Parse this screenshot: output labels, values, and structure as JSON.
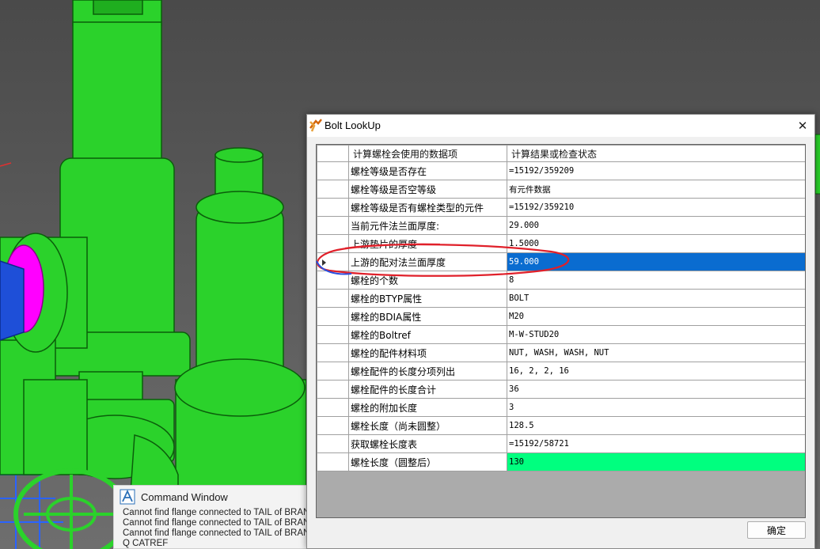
{
  "viewport": {
    "background": "#5a5a5a",
    "pipe_color": "#2bd22b",
    "flange_color": "#ff00ff",
    "pipe_blue": "#1e4fd8"
  },
  "command_window": {
    "title": "Command Window",
    "lines": [
      "Cannot find flange connected to TAIL of BRANC",
      "Cannot find flange connected to TAIL of BRANC",
      "Cannot find flange connected to TAIL of BRANC",
      "Q CATREF"
    ]
  },
  "dialog": {
    "title": "Bolt LookUp",
    "close_icon": "close-icon",
    "columns": [
      "计算螺栓会使用的数据项",
      "计算结果或检查状态"
    ],
    "rows": [
      {
        "item": "螺栓等级是否存在",
        "value": "=15192/359209"
      },
      {
        "item": "螺栓等级是否空等级",
        "value": "有元件数据"
      },
      {
        "item": "螺栓等级是否有螺栓类型的元件",
        "value": "=15192/359210"
      },
      {
        "item": "当前元件法兰面厚度:",
        "value": "29.000"
      },
      {
        "item": "上游垫片的厚度",
        "value": "1.5000"
      },
      {
        "item": "上游的配对法兰面厚度",
        "value": "59.000"
      },
      {
        "item": "螺栓的个数",
        "value": "8"
      },
      {
        "item": "螺栓的BTYP属性",
        "value": "BOLT"
      },
      {
        "item": "螺栓的BDIA属性",
        "value": "M20"
      },
      {
        "item": "螺栓的Boltref",
        "value": "M-W-STUD20"
      },
      {
        "item": "螺栓的配件材料项",
        "value": "NUT, WASH, WASH, NUT"
      },
      {
        "item": "螺栓配件的长度分项列出",
        "value": "16, 2, 2, 16"
      },
      {
        "item": "螺栓配件的长度合计",
        "value": "36"
      },
      {
        "item": "螺栓的附加长度",
        "value": "3"
      },
      {
        "item": "螺栓长度（尚未圆整）",
        "value": "128.5"
      },
      {
        "item": "获取螺栓长度表",
        "value": "=15192/58721"
      },
      {
        "item": "螺栓长度（圆整后）",
        "value": "130"
      }
    ],
    "selected_row": 5,
    "ok_label": "确定",
    "selection_color": "#0a6cd0",
    "highlight_color": "#00ff7f",
    "annotation_color": "#e0202a"
  }
}
